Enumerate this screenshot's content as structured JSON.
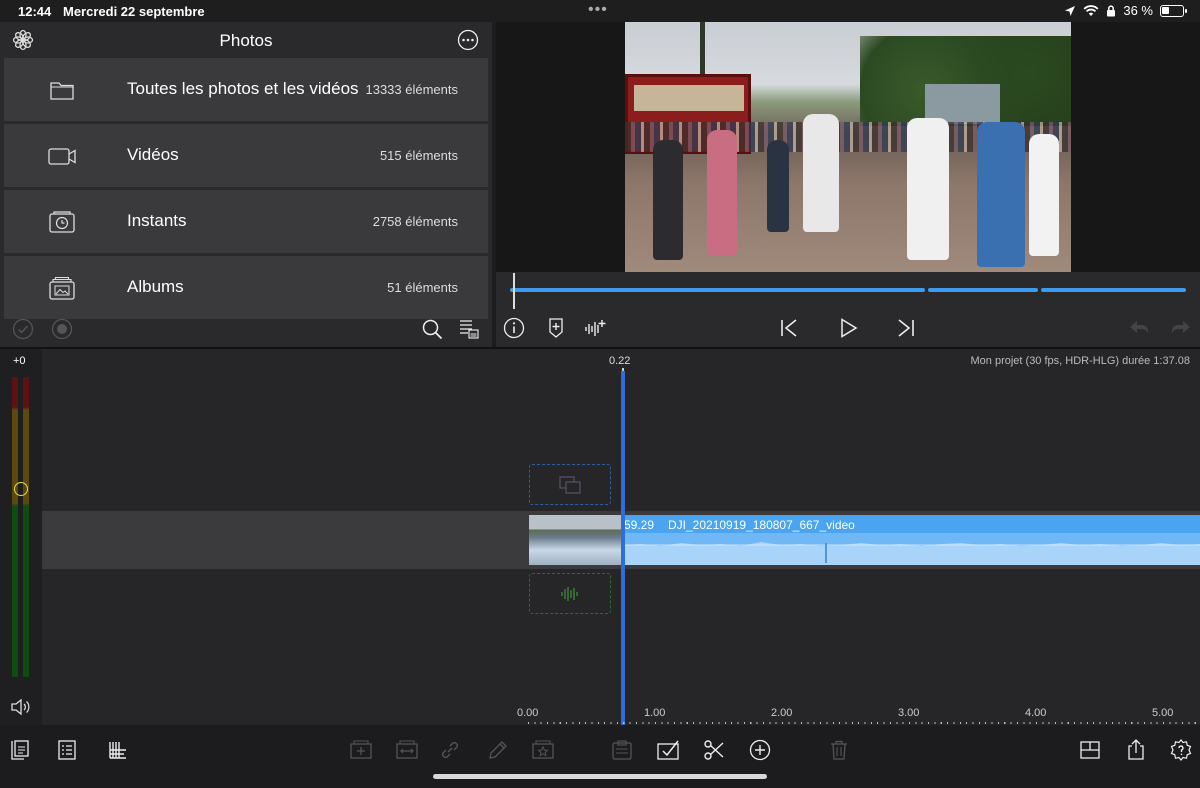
{
  "status_bar": {
    "time": "12:44",
    "date": "Mercredi 22 septembre",
    "battery": "36 %",
    "battery_level": 0.36
  },
  "browser": {
    "title": "Photos",
    "rows": [
      {
        "label": "Toutes les photos et les vidéos",
        "count": "13333 éléments",
        "icon": "folder-icon"
      },
      {
        "label": "Vidéos",
        "count": "515 éléments",
        "icon": "video-camera-icon"
      },
      {
        "label": "Instants",
        "count": "2758 éléments",
        "icon": "moments-clock-icon"
      },
      {
        "label": "Albums",
        "count": "51 éléments",
        "icon": "albums-icon"
      }
    ]
  },
  "timeline": {
    "playhead_time": "0.22",
    "project_info": "Mon projet (30 fps, HDR-HLG) durée 1:37.08",
    "meter_label": "+0",
    "clip": {
      "duration": "59.29",
      "name": "DJI_20210919_180807_667_video"
    },
    "ruler": [
      "0.00",
      "1.00",
      "2.00",
      "3.00",
      "4.00",
      "5.00"
    ]
  },
  "colors": {
    "accent": "#3d9cf0",
    "playhead": "#2f6ed8",
    "clip_audio": "#6fb8f5",
    "panel": "#2a2a2c"
  }
}
